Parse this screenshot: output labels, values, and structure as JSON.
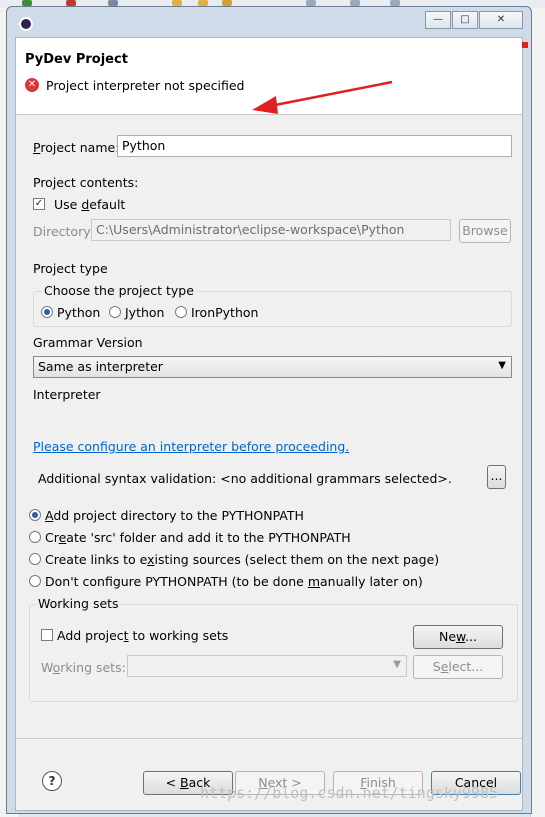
{
  "header": {
    "title": "PyDev Project",
    "error_message": "Project interpreter not specified"
  },
  "project_name": {
    "label": "Project name:",
    "value": "Python"
  },
  "project_contents": {
    "label": "Project contents:",
    "use_default": {
      "label": "Use default",
      "checked": true
    },
    "directory": {
      "label": "Directory",
      "value": "C:\\Users\\Administrator\\eclipse-workspace\\Python",
      "browse_label": "Browse"
    }
  },
  "project_type": {
    "label": "Project type",
    "group_title": "Choose the project type",
    "options": [
      "Python",
      "Jython",
      "IronPython"
    ],
    "selected": "Python"
  },
  "grammar": {
    "label": "Grammar Version",
    "selected": "Same as interpreter"
  },
  "interpreter": {
    "label": "Interpreter",
    "configure_link": "Please configure an interpreter before proceeding."
  },
  "syntax": {
    "text": "Additional syntax validation: <no additional grammars selected>.",
    "button": "..."
  },
  "pythonpath": {
    "options": [
      "Add project directory to the PYTHONPATH",
      "Create 'src' folder and add it to the PYTHONPATH",
      "Create links to existing sources (select them on the next page)",
      "Don't configure PYTHONPATH (to be done manually later on)"
    ],
    "selected_index": 0
  },
  "working_sets": {
    "title": "Working sets",
    "add_label": "Add project to working sets",
    "new_button": "New...",
    "sets_label": "Working sets:",
    "select_button": "Select..."
  },
  "footer": {
    "back": "< Back",
    "next": "Next >",
    "finish": "Finish",
    "cancel": "Cancel"
  },
  "watermark": "https://blog.csdn.net/tingsky9985",
  "colors": {
    "error": "#d9383a",
    "link": "#0066cc",
    "arrow": "#e02020"
  }
}
